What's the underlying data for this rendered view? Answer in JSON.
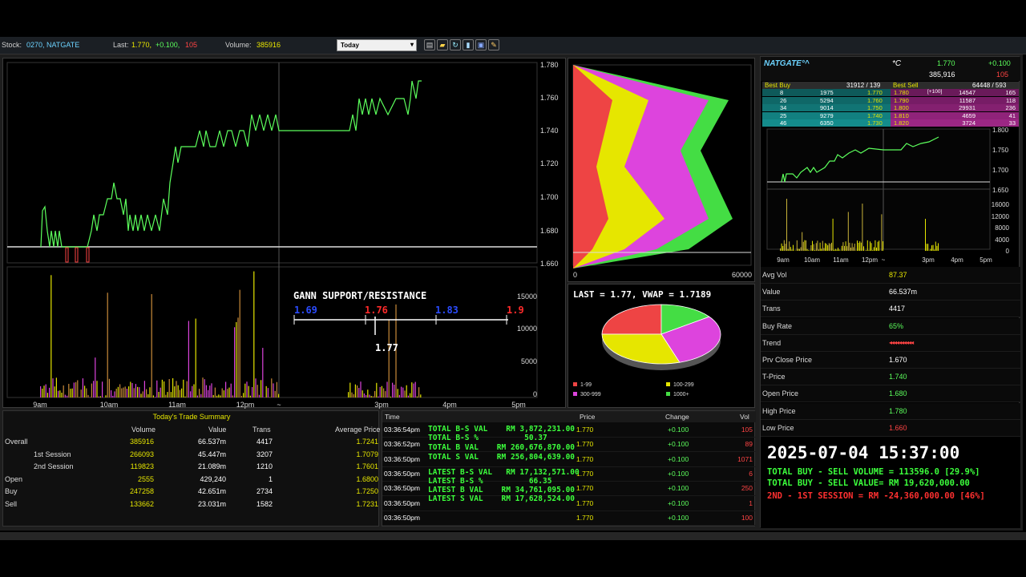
{
  "topbar": {
    "stock_label": "Stock:",
    "stock_value": "0270,  NATGATE",
    "last_label": "Last:",
    "last_price": "1.770,",
    "last_change": "+0.100,",
    "last_count": "105",
    "volume_label": "Volume:",
    "volume_value": "385916",
    "period": "Today"
  },
  "main_chart": {
    "yticks": [
      "1.780",
      "1.760",
      "1.740",
      "1.720",
      "1.700",
      "1.680",
      "1.660"
    ],
    "vol_ticks": [
      "15000",
      "10000",
      "5000",
      "0"
    ],
    "xticks": [
      "9am",
      "10am",
      "11am",
      "12pm",
      "~",
      "3pm",
      "4pm",
      "5pm"
    ],
    "gann_title": "GANN SUPPORT/RESISTANCE",
    "gann_levels": [
      "1.69",
      "1.76",
      "1.83",
      "1.9"
    ],
    "gann_current": "1.77"
  },
  "dist_chart": {
    "xticks": [
      "0",
      "60000"
    ]
  },
  "pie": {
    "title": "LAST = 1.77, VWAP = 1.7189",
    "legend": [
      "1-99",
      "100-299",
      "300-999",
      "1000+"
    ],
    "colors": [
      "#ee4444",
      "#e6e600",
      "#dd44dd",
      "#44dd44"
    ],
    "shares": [
      25,
      30,
      30,
      15
    ]
  },
  "summary": {
    "title": "Today's Trade Summary",
    "headers": [
      "Volume",
      "Value",
      "Trans",
      "Average Price"
    ],
    "rows": [
      [
        "Overall",
        "385916",
        "66.537m",
        "4417",
        "1.7241"
      ],
      [
        "1st Session",
        "266093",
        "45.447m",
        "3207",
        "1.7079"
      ],
      [
        "2nd Session",
        "119823",
        "21.089m",
        "1210",
        "1.7601"
      ],
      [
        "Open",
        "2555",
        "429,240",
        "1",
        "1.6800"
      ],
      [
        "Buy",
        "247258",
        "42.651m",
        "2734",
        "1.7250"
      ],
      [
        "Sell",
        "133662",
        "23.031m",
        "1582",
        "1.7231"
      ]
    ]
  },
  "trades": {
    "headers": [
      "Time",
      "Price",
      "Change",
      "Vol"
    ],
    "rows": [
      [
        "03:36:54pm",
        "1.770",
        "+0.100",
        "105"
      ],
      [
        "03:36:52pm",
        "1.770",
        "+0.100",
        "89"
      ],
      [
        "03:36:50pm",
        "1.770",
        "+0.100",
        "1071"
      ],
      [
        "03:36:50pm",
        "1.770",
        "+0.100",
        "6"
      ],
      [
        "03:36:50pm",
        "1.770",
        "+0.100",
        "250"
      ],
      [
        "03:36:50pm",
        "1.770",
        "+0.100",
        "1"
      ],
      [
        "03:36:50pm",
        "1.770",
        "+0.100",
        "100"
      ]
    ],
    "overlay": [
      "TOTAL B-S VAL    RM 3,872,231.00",
      "TOTAL B-S %          50.37",
      "TOTAL B VAL    RM 260,676,870.00",
      "TOTAL S VAL    RM 256,804,639.00",
      "LATEST B-S VAL   RM 17,132,571.00",
      "LATEST B-S %          66.35",
      "LATEST B VAL    RM 34,761,095.00",
      "LATEST S VAL    RM 17,628,524.00"
    ]
  },
  "quote": {
    "name": "NATGATE°^",
    "flag": "*C",
    "last": "1.770",
    "change": "+0.100",
    "volume": "385,916",
    "count": "105",
    "best_buy_label": "Best Buy",
    "best_buy_value": "31912 / 139",
    "best_sell_label": "Best Sell",
    "best_sell_value": "64448 / 593",
    "depth": [
      [
        "8",
        "1975",
        "1.770",
        "1.780",
        "",
        "14547",
        "165"
      ],
      [
        "26",
        "5294",
        "1.760",
        "1.790",
        "",
        "11587",
        "118"
      ],
      [
        "34",
        "9014",
        "1.750",
        "1.800",
        "",
        "29931",
        "236"
      ],
      [
        "25",
        "9279",
        "1.740",
        "1.810",
        "",
        "4659",
        "41"
      ],
      [
        "46",
        "6350",
        "1.730",
        "1.820",
        "",
        "3724",
        "33"
      ]
    ],
    "depth_tag": "[+100]"
  },
  "mini_chart": {
    "yticks": [
      "1.800",
      "1.750",
      "1.700",
      "1.650"
    ],
    "vticks": [
      "16000",
      "12000",
      "8000",
      "4000",
      "0"
    ],
    "xticks": [
      "9am",
      "10am",
      "11am",
      "12pm",
      "~",
      "3pm",
      "4pm",
      "5pm"
    ]
  },
  "stats": [
    [
      "Avg Vol",
      "87.37"
    ],
    [
      "Value",
      "66.537m"
    ],
    [
      "Trans",
      "4417"
    ],
    [
      "Buy Rate",
      "65%"
    ],
    [
      "Trend",
      ""
    ],
    [
      "Prv Close Price",
      "1.670"
    ],
    [
      "T-Price",
      "1.740"
    ],
    [
      "Open Price",
      "1.680"
    ],
    [
      "High Price",
      "1.780"
    ],
    [
      "Low Price",
      "1.660"
    ]
  ],
  "trend_arrows": "◂◂◂◂◂◂◂◂◂◂",
  "footer": {
    "datetime": "2025-07-04 15:37:00",
    "line1": "TOTAL BUY - SELL VOLUME = 113596.0 [29.9%]",
    "line2": "TOTAL BUY - SELL VALUE= RM 19,620,000.00",
    "line3": "2ND - 1ST SESSION = RM -24,360,000.00 [46%]"
  }
}
